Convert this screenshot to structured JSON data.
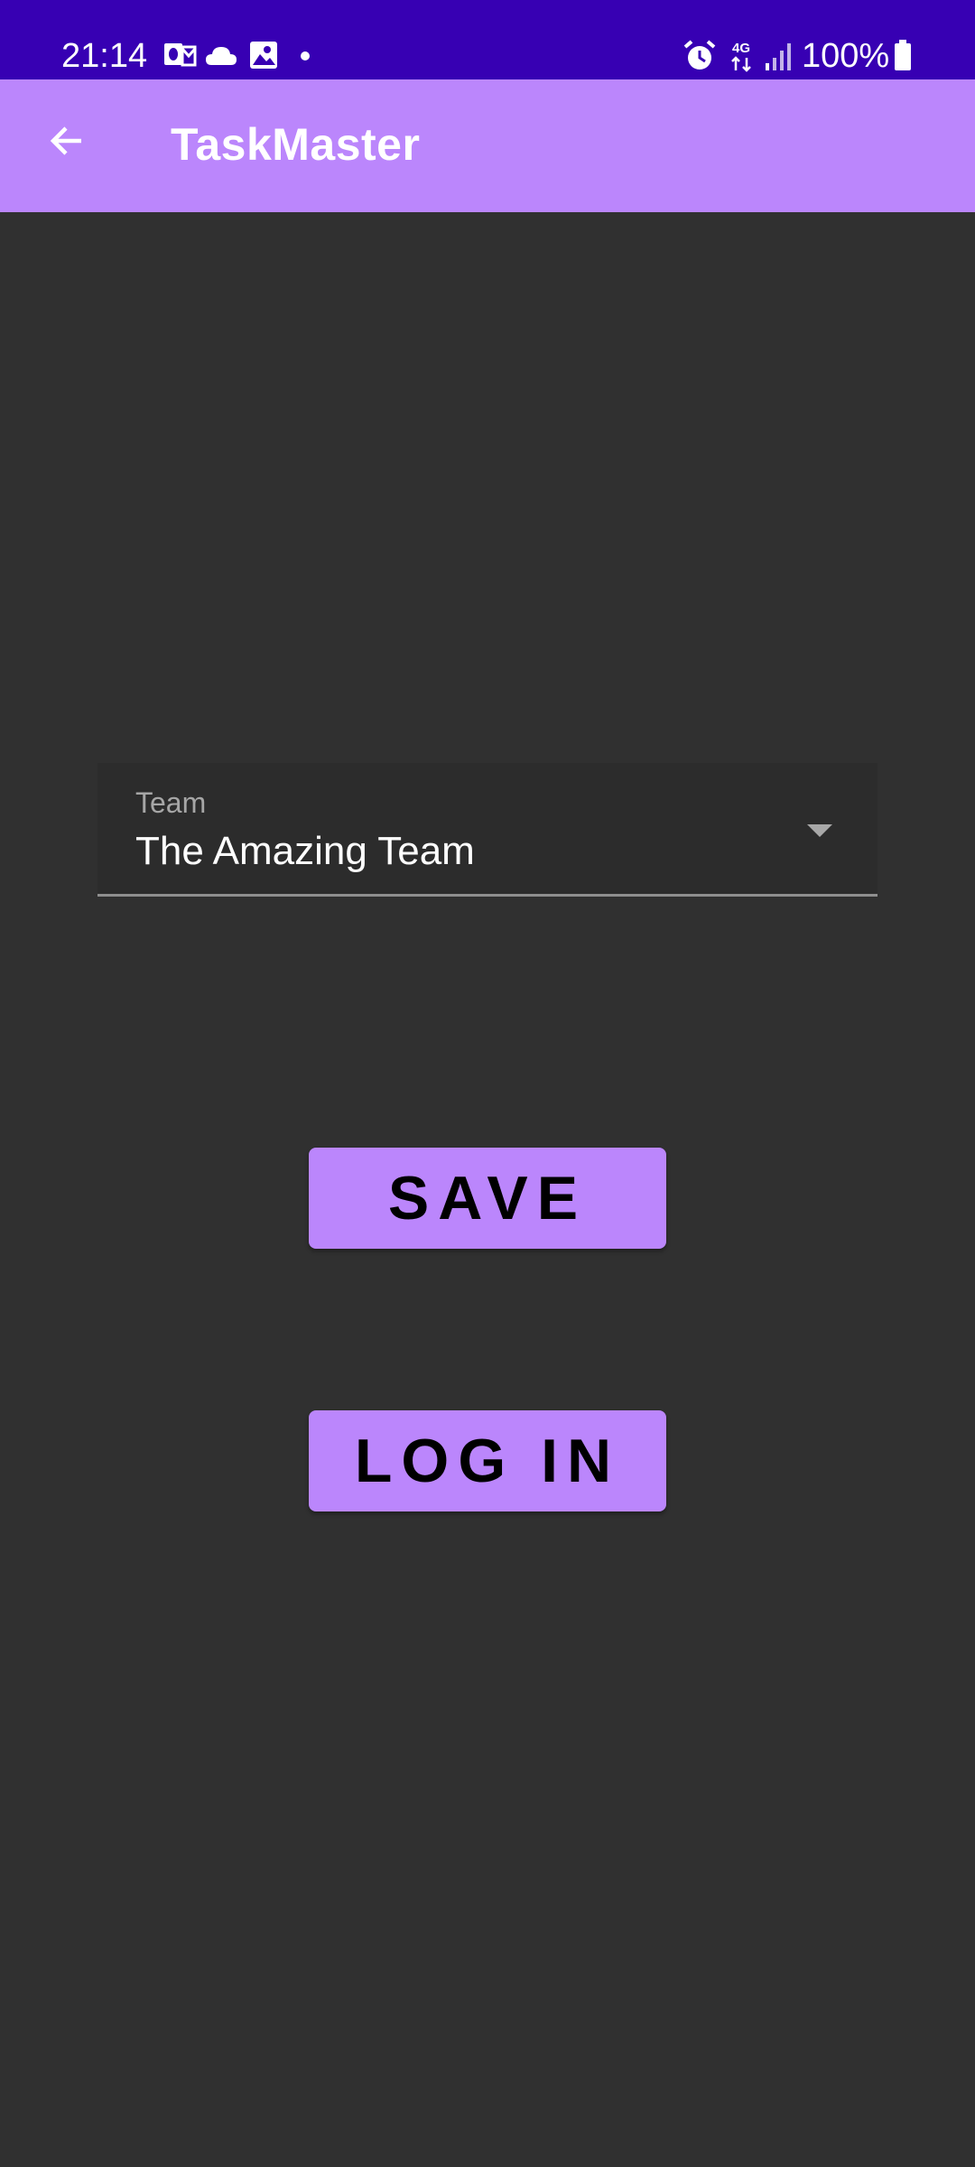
{
  "status_bar": {
    "time": "21:14",
    "battery_percent": "100%",
    "network_type": "4G",
    "icons": [
      "outlook-icon",
      "cloud-icon",
      "image-icon",
      "notification-dot-icon",
      "alarm-icon",
      "network-4g-icon",
      "signal-icon",
      "battery-icon"
    ]
  },
  "app_bar": {
    "title": "TaskMaster",
    "back_icon": "arrow-left-icon"
  },
  "team_selector": {
    "label": "Team",
    "value": "The Amazing Team"
  },
  "buttons": {
    "save_label": "SAVE",
    "login_label": "LOG IN"
  },
  "colors": {
    "status_bar": "#3700b3",
    "app_bar": "#bb86fc",
    "background": "#303030",
    "button": "#bb86fc"
  }
}
